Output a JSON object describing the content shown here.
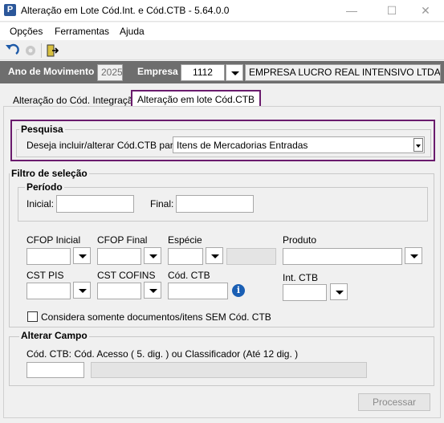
{
  "window": {
    "title": "Alteração em Lote Cód.Int. e Cód.CTB - 5.64.0.0",
    "icon_letter": "P",
    "minimize_glyph": "—",
    "maximize_glyph": "☐",
    "close_glyph": "✕"
  },
  "menu": [
    "Opções",
    "Ferramentas",
    "Ajuda"
  ],
  "toolbar": {
    "icons": [
      "undo-icon",
      "settings-icon-disabled",
      "exit-door-icon"
    ]
  },
  "header": {
    "ano_label": "Ano de Movimento",
    "ano_value": "2025",
    "empresa_label": "Empresa",
    "empresa_code": "1112",
    "empresa_name": "EMPRESA LUCRO REAL INTENSIVO LTDA"
  },
  "tabs": [
    {
      "label": "Alteração do Cód. Integração"
    },
    {
      "label": "Alteração em lote Cód.CTB"
    }
  ],
  "pesquisa": {
    "title": "Pesquisa",
    "label": "Deseja incluir/alterar Cód.CTB para:",
    "selected": "Itens de Mercadorias Entradas"
  },
  "filtro": {
    "title": "Filtro de seleção",
    "periodo": {
      "title": "Período",
      "inicial_label": "Inicial:",
      "final_label": "Final:"
    },
    "cfop_inicial_label": "CFOP Inicial",
    "cfop_final_label": "CFOP Final",
    "especie_label": "Espécie",
    "produto_label": "Produto",
    "cst_pis_label": "CST PIS",
    "cst_cofins_label": "CST COFINS",
    "cod_ctb_label": "Cód. CTB",
    "int_ctb_label": "Int. CTB",
    "checkbox_label": "Considera somente documentos/itens SEM Cód. CTB"
  },
  "alterar": {
    "title": "Alterar Campo",
    "label": "Cód. CTB: Cód. Acesso ( 5. dig. ) ou Classificador (Até 12 dig. )"
  },
  "processar_label": "Processar",
  "colors": {
    "accent": "#6a1b6d",
    "header_band": "#6e6e6e",
    "info": "#1a5fb4"
  }
}
